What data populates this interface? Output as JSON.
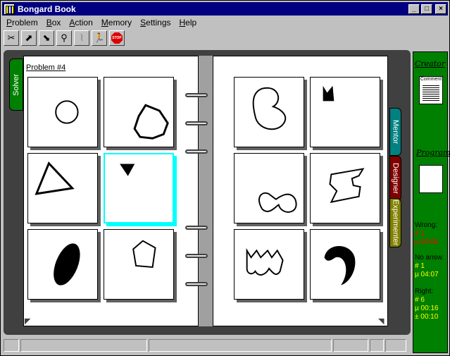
{
  "window": {
    "title": "Bongard Book"
  },
  "menu": [
    "Problem",
    "Box",
    "Action",
    "Memory",
    "Settings",
    "Help"
  ],
  "toolbar": [
    {
      "icon": "scissors-icon",
      "glyph": "✂"
    },
    {
      "icon": "open-box-icon",
      "glyph": "⬈"
    },
    {
      "icon": "save-box-icon",
      "glyph": "⬊"
    },
    {
      "icon": "binoculars-icon",
      "glyph": "⚲"
    },
    {
      "icon": "chart-icon",
      "glyph": "⌇"
    },
    {
      "icon": "runner-icon",
      "glyph": "🏃"
    },
    {
      "icon": "stop-icon",
      "glyph": "STOP"
    }
  ],
  "problem": {
    "label": "Problem #4"
  },
  "tabs": {
    "solver": "Solver",
    "mentor": "Mentor",
    "designer": "Designer",
    "experimenter": "Experimenter"
  },
  "sidebar": {
    "creator": "Creator",
    "comment": "Comment",
    "program": "Program",
    "wrong_label": "Wrong:",
    "wrong_count": "# 1",
    "wrong_time": "µ 00:00",
    "noanswer_label": "No answ.",
    "noanswer_count": "# 1",
    "noanswer_time": "µ 04:07",
    "right_label": "Right:",
    "right_count": "# 6",
    "right_mean": "µ 00:16",
    "right_dev": "± 00:10"
  },
  "colors": {
    "selected": "#00ffff",
    "sidebar": "#008000"
  }
}
